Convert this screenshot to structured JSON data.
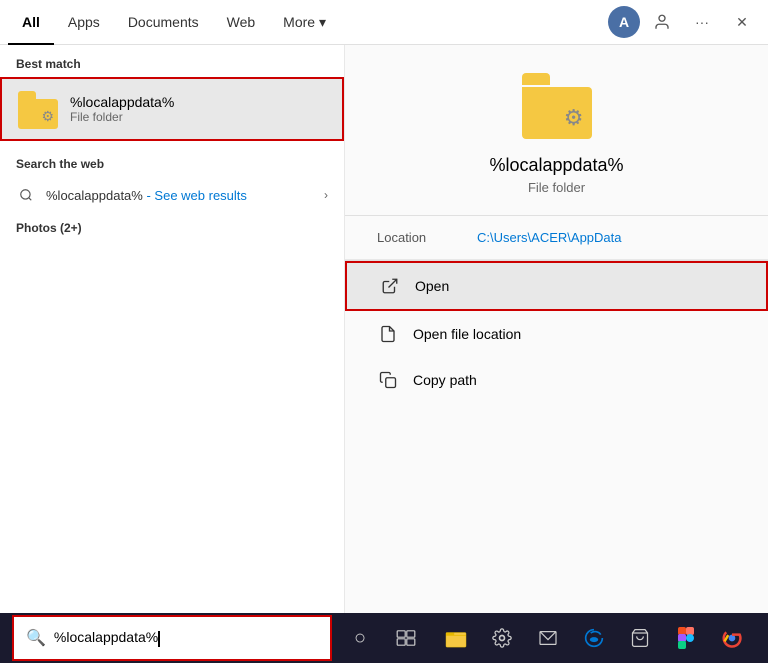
{
  "nav": {
    "tabs": [
      {
        "label": "All",
        "active": true
      },
      {
        "label": "Apps",
        "active": false
      },
      {
        "label": "Documents",
        "active": false
      },
      {
        "label": "Web",
        "active": false
      },
      {
        "label": "More ▾",
        "active": false
      }
    ],
    "avatar_label": "A",
    "dots_label": "···",
    "close_label": "✕",
    "person_icon": "👤"
  },
  "left": {
    "best_match_label": "Best match",
    "best_match_title": "%localappdata%",
    "best_match_subtitle": "File folder",
    "web_section_label": "Search the web",
    "web_query": "%localappdata%",
    "web_see_results": "- See web results",
    "photos_label": "Photos (2+)"
  },
  "right": {
    "preview_title": "%localappdata%",
    "preview_subtitle": "File folder",
    "location_label": "Location",
    "location_value": "C:\\Users\\ACER\\AppData",
    "actions": [
      {
        "label": "Open",
        "highlighted": true
      },
      {
        "label": "Open file location",
        "highlighted": false
      },
      {
        "label": "Copy path",
        "highlighted": false
      }
    ]
  },
  "searchbar": {
    "icon": "🔍",
    "value": "%localappdata%"
  },
  "taskbar": {
    "cortana_icon": "○",
    "task_view_icon": "⧉",
    "apps": [
      {
        "name": "File Explorer",
        "icon": "📁"
      },
      {
        "name": "Settings",
        "icon": "⚙"
      },
      {
        "name": "Mail",
        "icon": "✉"
      },
      {
        "name": "Edge",
        "icon": "⬡"
      },
      {
        "name": "Store",
        "icon": "🛍"
      },
      {
        "name": "Figma",
        "icon": "✦"
      },
      {
        "name": "Chrome",
        "icon": "●"
      }
    ]
  }
}
